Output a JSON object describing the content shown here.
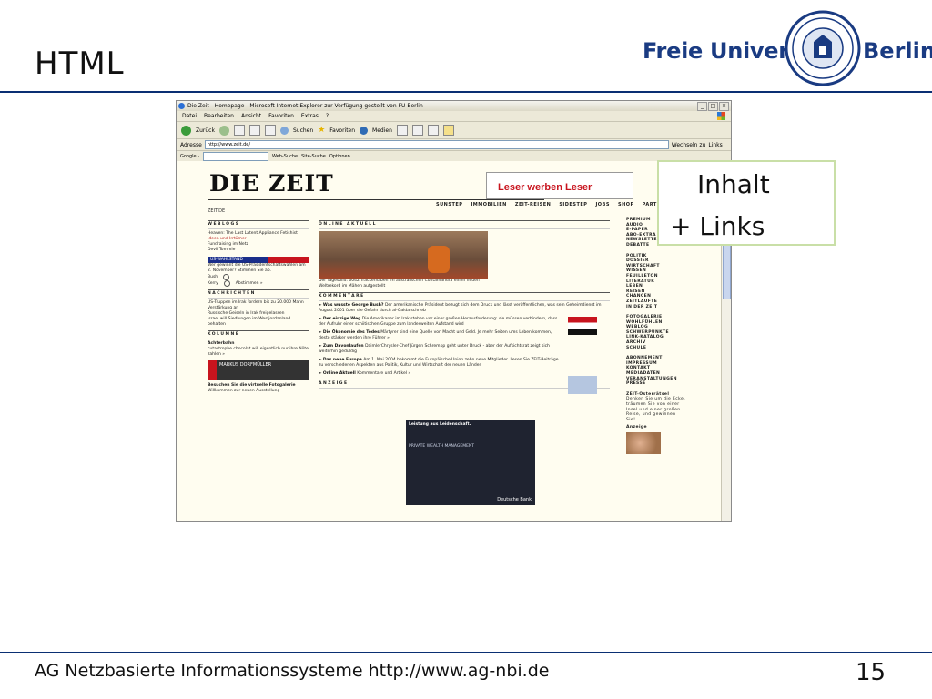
{
  "slide": {
    "title": "HTML",
    "footer": "AG Netzbasierte Informationssysteme http://www.ag-nbi.de",
    "page_number": "15",
    "logo_left": "Freie Universität",
    "logo_right": "Berlin",
    "overlay_line1": "Inhalt",
    "overlay_line2": "+ Links"
  },
  "browser": {
    "window_title": "Die Zeit - Homepage - Microsoft Internet Explorer zur Verfügung gestellt von FU-Berlin",
    "menu": [
      "Datei",
      "Bearbeiten",
      "Ansicht",
      "Favoriten",
      "Extras",
      "?"
    ],
    "toolbar": {
      "back": "Zurück",
      "search": "Suchen",
      "favorites": "Favoriten",
      "media": "Medien"
    },
    "address_label": "Adresse",
    "address_value": "http://www.zeit.de/",
    "go_label": "Wechseln zu",
    "links_label": "Links",
    "google_label": "Google -",
    "google_btn1": "Web-Suche",
    "google_btn2": "Site-Suche",
    "google_btn3": "Optionen"
  },
  "zeit": {
    "logo": "DIE ZEIT",
    "ad_text": "Leser werben Leser",
    "nav": [
      "SUNSTEP",
      "IMMOBILIEN",
      "ZEIT-REISEN",
      "SIDESTEP",
      "JOBS",
      "SHOP",
      "PARTNER"
    ],
    "zeitde": "ZEIT.DE",
    "left": {
      "weblogs": "WEBLOGS",
      "weblog1": "Heaven: The Last Latent Appliance Fetishist",
      "weblog2": "Ideen und Irrtümer",
      "weblog3": "Fundraising im Netz",
      "weblog4": "Devil Tommie",
      "us_title": "US-WAHLSTAND",
      "us_q": "Wer gewinnt die US-Präsidentschaftswahlen am 2. November? Stimmen Sie ab.",
      "bush": "Bush",
      "kerry": "Kerry",
      "vote": "Abstimmen »",
      "nachrichten": "NACHRICHTEN",
      "news1": "US-Truppen im Irak fordern bis zu 20.000 Mann Verstärkung an",
      "news2": "Russische Geiseln in Irak freigelassen",
      "news3": "Israel will Siedlungen im Westjordanland behalten",
      "kolumne": "KOLUMNE",
      "kolumne_title": "Achterbahn",
      "kolumne_text": "cutastrophe chocolat will eigentlich nur ihre Nöte zahlen »",
      "author": "MARKUS DORFMÜLLER",
      "gallery": "Besuchen Sie die virtuelle Fotogalerie",
      "gallery2": "Willkommen zur neuen Ausstellung"
    },
    "mid": {
      "online": "ONLINE AKTUELL",
      "caption": "Der Tagesbild: 6042 Trackerhaben im australischen Contamandra einen neuen Weltrekord im Mähen aufgestellt",
      "kommentare": "KOMMENTARE",
      "b1_t": "Was wusste George Bush?",
      "b1": "Der amerikanische Präsident bezugt sich dem Druck und lässt veröffentlichen, was sein Geheimdienst im August 2001 über die Gefahr durch al-Qaida schrieb",
      "b2_t": "Der einzige Weg",
      "b2": "Die Amerikaner im Irak stehen vor einer großen Herausforderung: sie müssen verhindern, dass der Aufruhr einer schiitischen Gruppe zum landesweiten Aufstand wird",
      "b3_t": "Die Ökonomie des Todes",
      "b3": "Märtyrer sind eine Quelle von Macht und Geld. Je mehr Seiten ums Leben kommen, desto stärker werden ihre Führer »",
      "b4_t": "Zum Davonlaufen",
      "b4": "DaimlerChrysler-Chef Jürgen Schrempp geht unter Druck - aber der Aufsichtsrat zeigt sich weiterhin geduldig",
      "b5_t": "Das neue Europa",
      "b5": "Am 1. Mai 2004 bekommt die Europäische Union zehn neue Mitglieder. Lesen Sie ZEIT-Beiträge zu verschiedenen Aspekten aus Politik, Kultur und Wirtschaft der neuen Länder.",
      "b6_t": "Online Aktuell",
      "b6": "Kommentare und Artikel »",
      "anzeige": "ANZEIGE",
      "ad_head": "Leistung aus Leidenschaft.",
      "ad_sub": "PRIVATE WEALTH MANAGEMENT",
      "ad_bank": "Deutsche Bank"
    },
    "right": {
      "group1": [
        "PREMIUM",
        "AUDIO",
        "E-PAPER",
        "ABO-EXTRA",
        "NEWSLETTER",
        "DEBATTE"
      ],
      "group2": [
        "POLITIK",
        "DOSSIER",
        "WIRTSCHAFT",
        "WISSEN",
        "FEUILLETON",
        "LITERATUR",
        "LEBEN",
        "REISEN",
        "CHANCEN",
        "ZEITLÄUFTE",
        "IN DER ZEIT"
      ],
      "group3": [
        "FOTOGALERIE",
        "WOHLFÜHLEN",
        "WEBLOG",
        "SCHWERPUNKTE",
        "LINK-KATALOG",
        "ARCHIV",
        "SCHULE"
      ],
      "group4": [
        "ABONNEMENT",
        "IMPRESSUM",
        "KONTAKT",
        "MEDIADATEN",
        "VERANSTALTUNGEN",
        "PRESSE"
      ],
      "ostern": "ZEIT-Osterrätsel",
      "ostern_text": "Denken Sie um die Ecke, träumen Sie von einer Insel und einer großen Reise, und gewinnen Sie!",
      "anzeige": "Anzeige"
    }
  }
}
